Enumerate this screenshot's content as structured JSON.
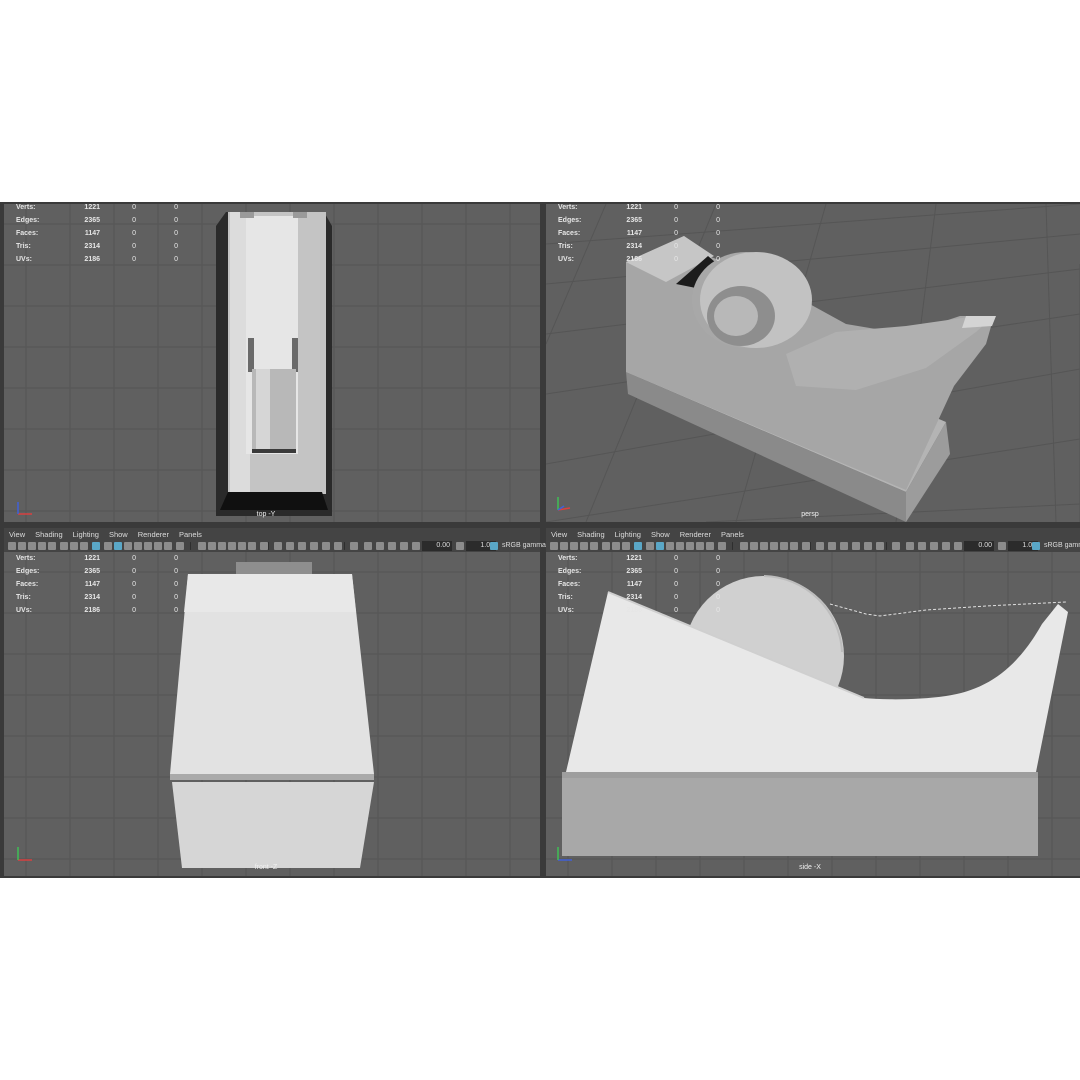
{
  "stats": {
    "rows": [
      {
        "label": "Verts:",
        "v1": "1221",
        "v2": "0",
        "v3": "0"
      },
      {
        "label": "Edges:",
        "v1": "2365",
        "v2": "0",
        "v3": "0"
      },
      {
        "label": "Faces:",
        "v1": "1147",
        "v2": "0",
        "v3": "0"
      },
      {
        "label": "Tris:",
        "v1": "2314",
        "v2": "0",
        "v3": "0"
      },
      {
        "label": "UVs:",
        "v1": "2186",
        "v2": "0",
        "v3": "0"
      }
    ]
  },
  "menu": [
    "View",
    "Shading",
    "Lighting",
    "Show",
    "Renderer",
    "Panels"
  ],
  "toolbar": {
    "exposure": "0.00",
    "gamma": "1.00",
    "color_space": "sRGB gamma"
  },
  "cameras": {
    "top": "top -Y",
    "persp": "persp",
    "front": "front -Z",
    "side": "side -X"
  },
  "colors": {
    "viewport_bg": "#606060",
    "grid": "#555555",
    "accent": "#5aa7c7"
  }
}
